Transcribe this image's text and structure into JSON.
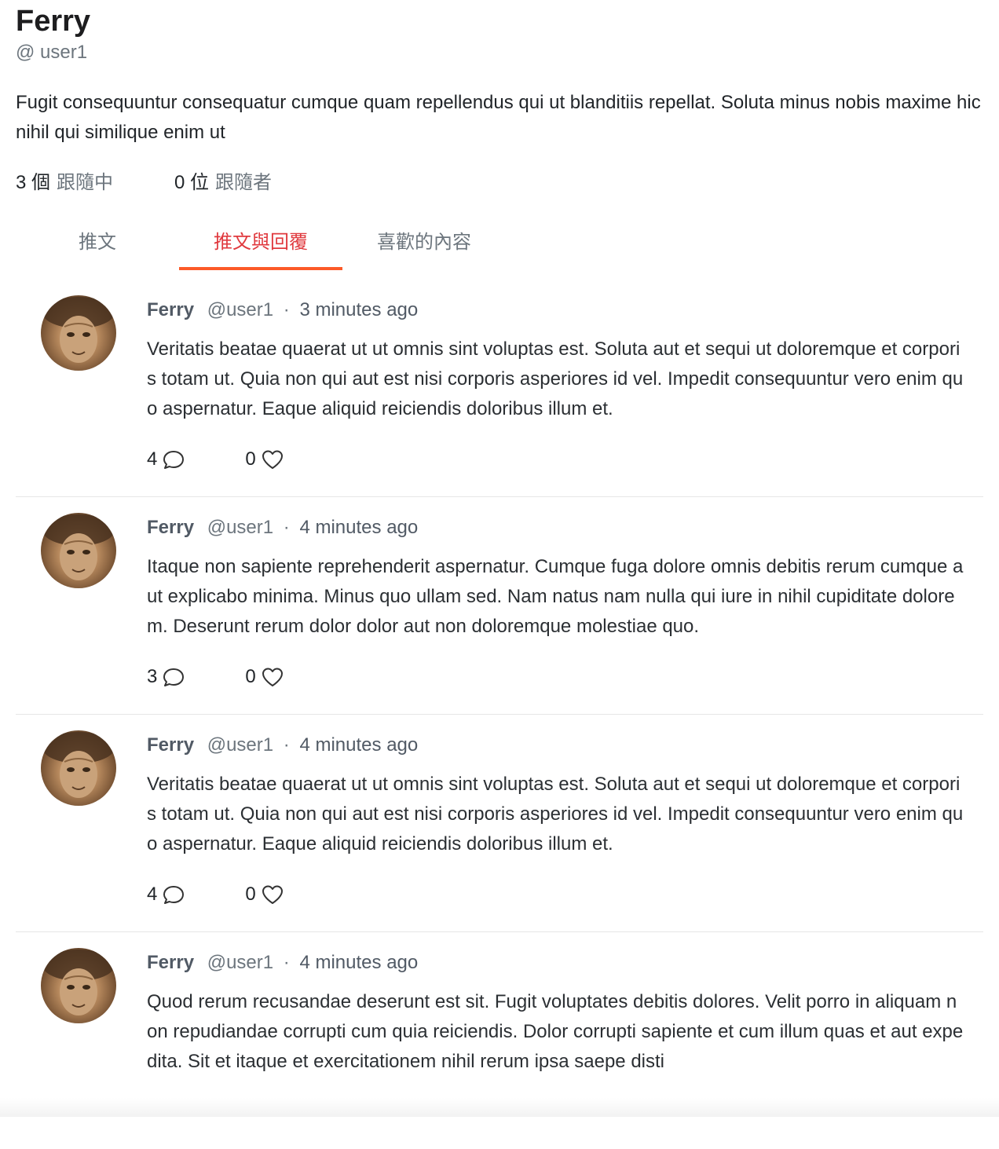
{
  "profile": {
    "name": "Ferry",
    "handle": "@ user1",
    "bio": "Fugit consequuntur consequatur cumque quam repellendus qui ut blanditiis repellat. Soluta minus nobis maxime hic nihil qui similique enim ut",
    "following_count": "3 個",
    "following_label": "跟隨中",
    "followers_count": "0 位",
    "followers_label": "跟隨者"
  },
  "tabs": [
    {
      "label": "推文",
      "active": false
    },
    {
      "label": "推文與回覆",
      "active": true
    },
    {
      "label": "喜歡的內容",
      "active": false
    }
  ],
  "colors": {
    "accent": "#e0393e",
    "tab_underline": "#fc5a28",
    "muted": "#6c757d"
  },
  "tweets": [
    {
      "user": "Ferry",
      "handle": "@user1",
      "separator": "·",
      "time": "3 minutes ago",
      "body": "Veritatis beatae quaerat ut ut omnis sint voluptas est. Soluta aut et sequi ut doloremque et corporis totam ut. Quia non qui aut est nisi corporis asperiores id vel. Impedit consequuntur vero enim quo aspernatur. Eaque aliquid reiciendis doloribus illum et.",
      "replies": "4",
      "likes": "0"
    },
    {
      "user": "Ferry",
      "handle": "@user1",
      "separator": "·",
      "time": "4 minutes ago",
      "body": "Itaque non sapiente reprehenderit aspernatur. Cumque fuga dolore omnis debitis rerum cumque aut explicabo minima. Minus quo ullam sed. Nam natus nam nulla qui iure in nihil cupiditate dolorem. Deserunt rerum dolor dolor aut non doloremque molestiae quo.",
      "replies": "3",
      "likes": "0"
    },
    {
      "user": "Ferry",
      "handle": "@user1",
      "separator": "·",
      "time": "4 minutes ago",
      "body": "Veritatis beatae quaerat ut ut omnis sint voluptas est. Soluta aut et sequi ut doloremque et corporis totam ut. Quia non qui aut est nisi corporis asperiores id vel. Impedit consequuntur vero enim quo aspernatur. Eaque aliquid reiciendis doloribus illum et.",
      "replies": "4",
      "likes": "0"
    },
    {
      "user": "Ferry",
      "handle": "@user1",
      "separator": "·",
      "time": "4 minutes ago",
      "body": "Quod rerum recusandae deserunt est sit. Fugit voluptates debitis dolores. Velit porro in aliquam non repudiandae corrupti cum quia reiciendis. Dolor corrupti sapiente et cum illum quas et aut expedita. Sit et itaque et exercitationem nihil rerum ipsa saepe disti",
      "replies": "",
      "likes": ""
    }
  ]
}
